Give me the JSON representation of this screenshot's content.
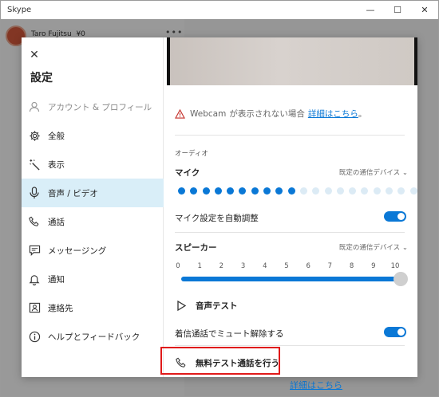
{
  "window": {
    "title": "Skype",
    "minimize": "—",
    "maximize": "☐",
    "close": "✕"
  },
  "background": {
    "user_name": "Taro Fujitsu",
    "balance": "¥0",
    "more": "•••",
    "detail_link": "詳細はこちら"
  },
  "settings": {
    "close_glyph": "✕",
    "title": "設定",
    "nav": [
      {
        "label": "アカウント & プロフィール",
        "icon": "person-icon"
      },
      {
        "label": "全般",
        "icon": "gear-icon"
      },
      {
        "label": "表示",
        "icon": "magic-wand-icon"
      },
      {
        "label": "音声 / ビデオ",
        "icon": "microphone-icon"
      },
      {
        "label": "通話",
        "icon": "phone-icon"
      },
      {
        "label": "メッセージング",
        "icon": "chat-icon"
      },
      {
        "label": "通知",
        "icon": "bell-icon"
      },
      {
        "label": "連絡先",
        "icon": "contact-card-icon"
      },
      {
        "label": "ヘルプとフィードバック",
        "icon": "info-icon"
      }
    ],
    "active_index": 3
  },
  "content": {
    "warning": {
      "prefix": "Webcam",
      "text": "が表示されない場合",
      "link": "詳細はこちら",
      "suffix": "。"
    },
    "audio_section": "オーディオ",
    "mic": {
      "label": "マイク",
      "device": "既定の通信デバイス",
      "level_dots": 21,
      "active_dots": 10
    },
    "mic_auto": {
      "label": "マイク設定を自動調整",
      "on": true
    },
    "speaker": {
      "label": "スピーカー",
      "device": "既定の通信デバイス",
      "scale": [
        "0",
        "1",
        "2",
        "3",
        "4",
        "5",
        "6",
        "7",
        "8",
        "9",
        "10"
      ],
      "volume": 10
    },
    "sound_test": "音声テスト",
    "unmute": {
      "label": "着信通話でミュート解除する",
      "on": true
    },
    "free_test_call": "無料テスト通話を行う"
  },
  "colors": {
    "accent": "#0a78d6",
    "active_nav": "#d9eef8",
    "highlight_border": "#e01919",
    "warning": "#c5312b",
    "dot_inactive": "#dcebf5"
  }
}
